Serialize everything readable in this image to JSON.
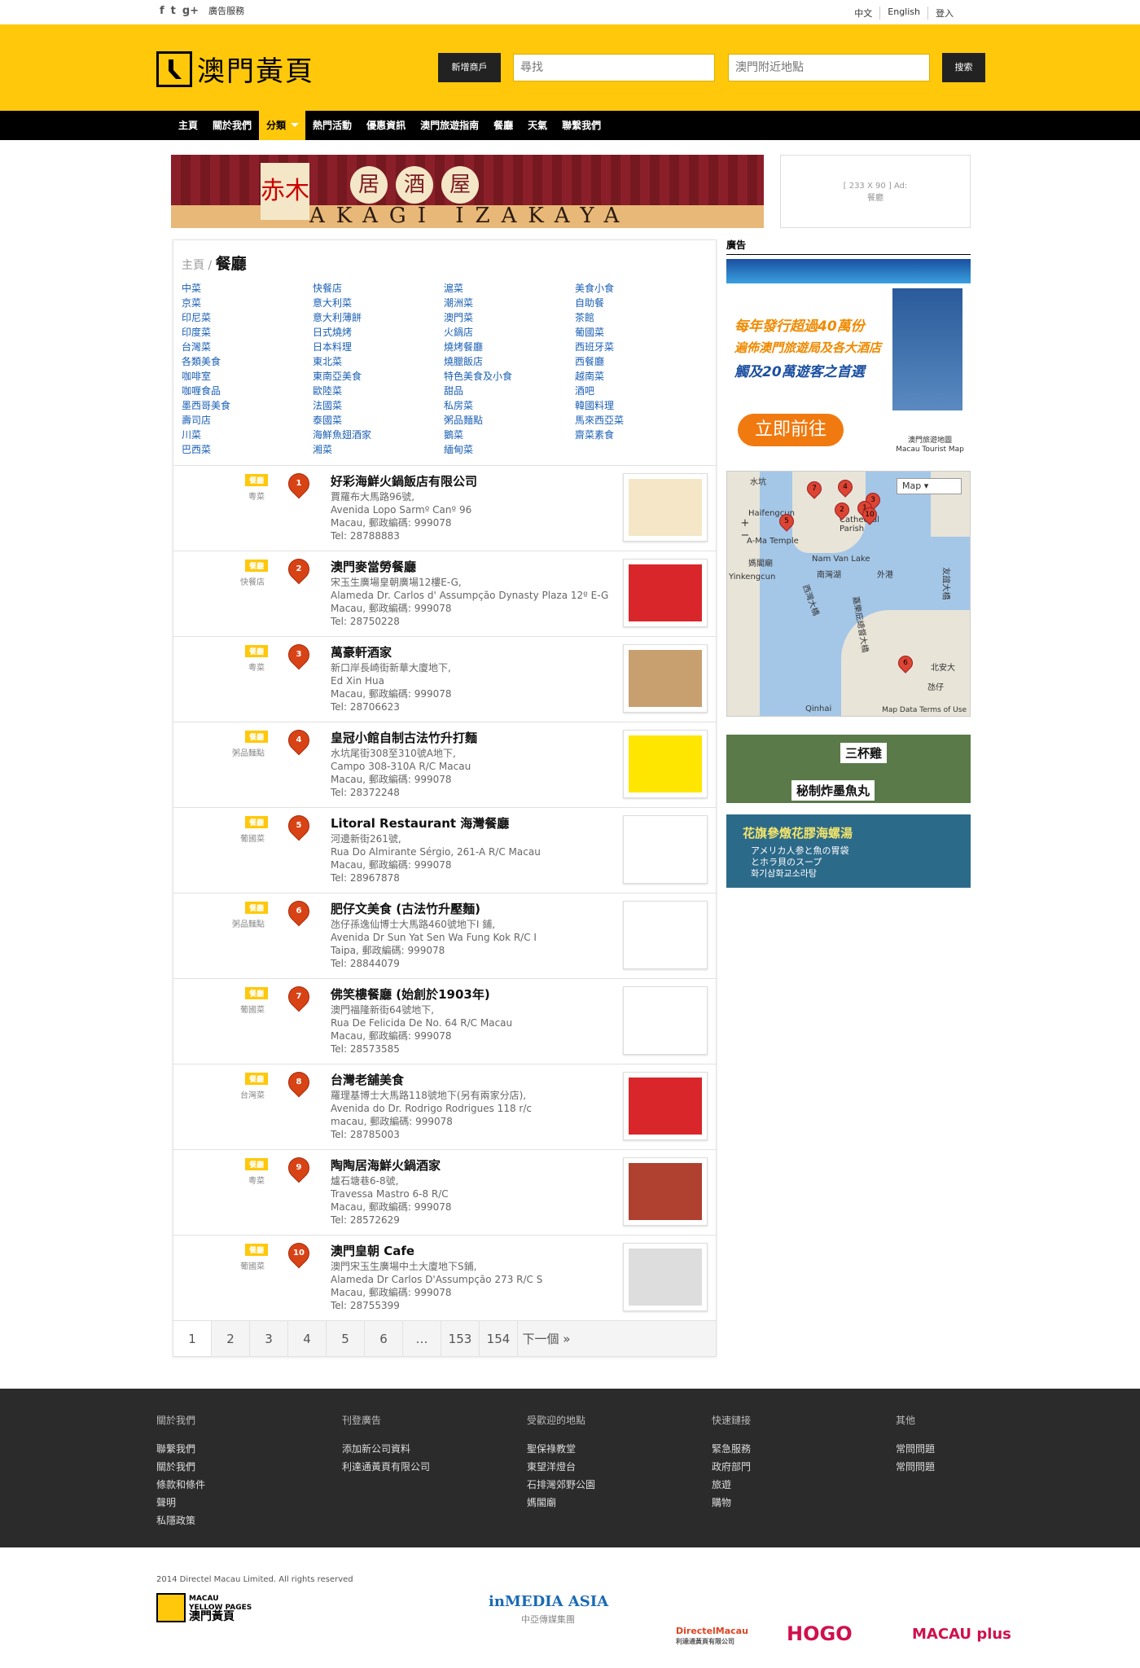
{
  "top": {
    "social": [
      "f",
      "t",
      "g+"
    ],
    "ad_service": "廣告服務",
    "links": [
      "中文",
      "English",
      "登入"
    ]
  },
  "header": {
    "logo_text": "澳門黃頁",
    "add_business": "新增商戶",
    "search_placeholder": "尋找",
    "location_placeholder": "澳門附近地點",
    "search_button": "搜索"
  },
  "nav": [
    "主頁",
    "關於我們",
    "分類",
    "熱門活動",
    "優惠資訊",
    "澳門旅遊指南",
    "餐廳",
    "天氣",
    "聯繫我們"
  ],
  "banner": {
    "kanji": [
      "居",
      "酒",
      "屋"
    ],
    "brand": "赤木",
    "text": "AKAGI IZAKAYA"
  },
  "adbox": {
    "line1": "[ 233 X 90 ] Ad:",
    "line2": "餐廳"
  },
  "breadcrumb": {
    "home": "主頁",
    "sep": "/",
    "current": "餐廳"
  },
  "categories": [
    "中菜",
    "快餐店",
    "滬菜",
    "美食小食",
    "京菜",
    "意大利菜",
    "潮洲菜",
    "自助餐",
    "印尼菜",
    "意大利薄餅",
    "澳門菜",
    "茶館",
    "印度菜",
    "日式燒烤",
    "火鍋店",
    "葡國菜",
    "台灣菜",
    "日本料理",
    "燒烤餐廳",
    "西班牙菜",
    "各類美食",
    "東北菜",
    "燒臘飯店",
    "西餐廳",
    "咖啡室",
    "東南亞美食",
    "特色美食及小食",
    "越南菜",
    "咖喱食品",
    "歐陸菜",
    "甜品",
    "酒吧",
    "墨西哥美食",
    "法國菜",
    "私房菜",
    "韓國料理",
    "壽司店",
    "泰國菜",
    "粥品麵點",
    "馬來西亞菜",
    "川菜",
    "海鮮魚翅酒家",
    "鵝菜",
    "齋菜素食",
    "巴西菜",
    "湘菜",
    "緬甸菜",
    ""
  ],
  "listings": [
    {
      "num": "1",
      "badge": "餐廳",
      "sub": "粵菜",
      "name": "好彩海鮮火鍋飯店有限公司",
      "addr": "賈羅布大馬路96號,\nAvenida Lopo Sarmº Canº 96\nMacau, 郵政編碼: 999078\nTel: 28788883",
      "thumb_color": "#f5e6c8"
    },
    {
      "num": "2",
      "badge": "餐廳",
      "sub": "快餐店",
      "name": "澳門麥當勞餐廳",
      "addr": "宋玉生廣場皇朝廣場12樓E-G,\nAlameda Dr. Carlos d' Assumpção Dynasty Plaza 12º E-G\nMacau, 郵政編碼: 999078\nTel: 28750228",
      "thumb_color": "#d9262b"
    },
    {
      "num": "3",
      "badge": "餐廳",
      "sub": "粵菜",
      "name": "萬豪軒酒家",
      "addr": "新口岸長崎街新華大廈地下,\nEd Xin Hua\nMacau, 郵政編碼: 999078\nTel: 28706623",
      "thumb_color": "#c8a070"
    },
    {
      "num": "4",
      "badge": "餐廳",
      "sub": "粥品麵點",
      "name": "皇冠小館自制古法竹升打麵",
      "addr": "水坑尾街308至310號A地下,\nCampo 308-310A R/C Macau\nMacau, 郵政編碼: 999078\nTel: 28372248",
      "thumb_color": "#ffe600"
    },
    {
      "num": "5",
      "badge": "餐廳",
      "sub": "葡國菜",
      "name": "Litoral Restaurant 海灣餐廳",
      "addr": "河邊新街261號,\nRua Do Almirante Sérgio, 261-A R/C Macau\nMacau, 郵政編碼: 999078\nTel: 28967878",
      "thumb_color": "#ffffff"
    },
    {
      "num": "6",
      "badge": "餐廳",
      "sub": "粥品麵點",
      "name": "肥仔文美食 (古法竹升壓麵)",
      "addr": "氹仔孫逸仙博士大馬路460號地下I 鋪,\nAvenida Dr Sun Yat Sen Wa Fung Kok R/C I\nTaipa, 郵政編碼: 999078\nTel: 28844079",
      "thumb_color": "#ffffff"
    },
    {
      "num": "7",
      "badge": "餐廳",
      "sub": "葡國菜",
      "name": "佛笑樓餐廳 (始創於1903年)",
      "addr": "澳門福隆新街64號地下,\nRua De Felicida De No. 64 R/C Macau\nMacau, 郵政編碼: 999078\nTel: 28573585",
      "thumb_color": "#ffffff"
    },
    {
      "num": "8",
      "badge": "餐廳",
      "sub": "台灣菜",
      "name": "台灣老舖美食",
      "addr": "羅理基博士大馬路118號地下(另有兩家分店),\nAvenida do Dr. Rodrigo Rodrigues 118 r/c\nmacau, 郵政編碼: 999078\nTel: 28785003",
      "thumb_color": "#d8262b"
    },
    {
      "num": "9",
      "badge": "餐廳",
      "sub": "粵菜",
      "name": "陶陶居海鮮火鍋酒家",
      "addr": "爐石塘巷6-8號,\nTravessa Mastro 6-8 R/C\nMacau, 郵政編碼: 999078\nTel: 28572629",
      "thumb_color": "#b04030"
    },
    {
      "num": "10",
      "badge": "餐廳",
      "sub": "葡國菜",
      "name": "澳門皇朝 Cafe",
      "addr": "澳門宋玉生廣場中土大廈地下S鋪,\nAlameda Dr Carlos D'Assumpção 273 R/C S\nMacau, 郵政編碼: 999078\nTel: 28755399",
      "thumb_color": "#dddddd"
    }
  ],
  "pager": [
    "1",
    "2",
    "3",
    "4",
    "5",
    "6",
    "…",
    "153",
    "154",
    "下一個 »"
  ],
  "sidebar": {
    "title": "廣告",
    "ad1": {
      "line1": "每年發行超過40萬份",
      "line2": "遍佈澳門旅遊局及各大酒店",
      "line3": "觸及20萬遊客之首選",
      "go": "立即前往",
      "caption1": "澳門旅遊地圖",
      "caption2": "Macau Tourist Map"
    },
    "map": {
      "type": "Map",
      "labels": [
        "水坑",
        "Haifengcun",
        "A-Ma Temple",
        "媽閣廟",
        "Yinkengcun",
        "Nam Van Lake",
        "南灣湖",
        "外港",
        "西灣大橋",
        "嘉樂庇總督大橋",
        "友誼大橋",
        "北安大",
        "氹仔",
        "Qinhai",
        "Cathedral Parish"
      ],
      "footer": "Map Data    Terms of Use"
    },
    "ad2": {
      "line1": "三杯雞",
      "line2": "秘制炸墨魚丸"
    },
    "ad3": {
      "line1": "花旗參燉花膠海螺湯",
      "line2": "アメリカ人参と魚の胃袋\nとホラ貝のスープ\n화기삼화교소라탕"
    }
  },
  "footer": {
    "cols": [
      {
        "title": "關於我們",
        "items": [
          "聯繫我們",
          "關於我們",
          "條款和條件",
          "聲明",
          "私隱政策"
        ]
      },
      {
        "title": "刊登廣告",
        "items": [
          "添加新公司資料",
          "利達通黃頁有限公司"
        ]
      },
      {
        "title": "受歡迎的地點",
        "items": [
          "聖保祿教堂",
          "東望洋燈台",
          "石排灣郊野公園",
          "媽閣廟"
        ]
      },
      {
        "title": "快速鏈接",
        "items": [
          "緊急服務",
          "政府部門",
          "旅遊",
          "購物"
        ]
      },
      {
        "title": "其他",
        "items": [
          "常問問題",
          "常問問題"
        ]
      }
    ],
    "copyright": "2014 Directel Macau Limited. All rights reserved",
    "logo_line1": "MACAU",
    "logo_line2": "YELLOW PAGES",
    "logo_line3": "澳門黃頁",
    "partners": [
      "inMEDIA ASIA",
      "中亞傳媒集團",
      "DirectelMacau",
      "利達通黃頁有限公司",
      "HOGO",
      "MACAU plus"
    ]
  }
}
